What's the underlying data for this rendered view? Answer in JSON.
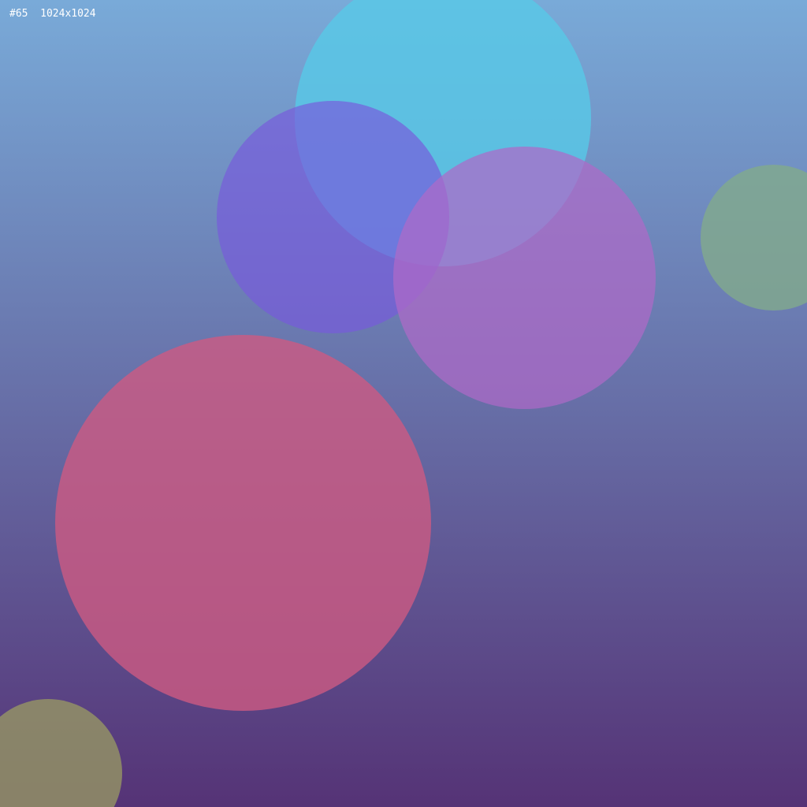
{
  "label": {
    "id": "#65",
    "size": "1024x1024"
  },
  "background": {
    "top_color": "#79AAD8",
    "bottom_color": "#553376"
  },
  "circles": [
    {
      "name": "cyan-circle",
      "color": "rgba(88, 200, 230, 0.82)"
    },
    {
      "name": "violet-circle",
      "color": "rgba(120, 90, 220, 0.68)"
    },
    {
      "name": "orchid-circle",
      "color": "rgba(175, 105, 200, 0.72)"
    },
    {
      "name": "sage-circle",
      "color": "rgba(130, 170, 140, 0.80)"
    },
    {
      "name": "rose-circle",
      "color": "rgba(205, 90, 130, 0.80)"
    },
    {
      "name": "olive-circle",
      "color": "rgba(150, 150, 100, 0.80)"
    }
  ]
}
